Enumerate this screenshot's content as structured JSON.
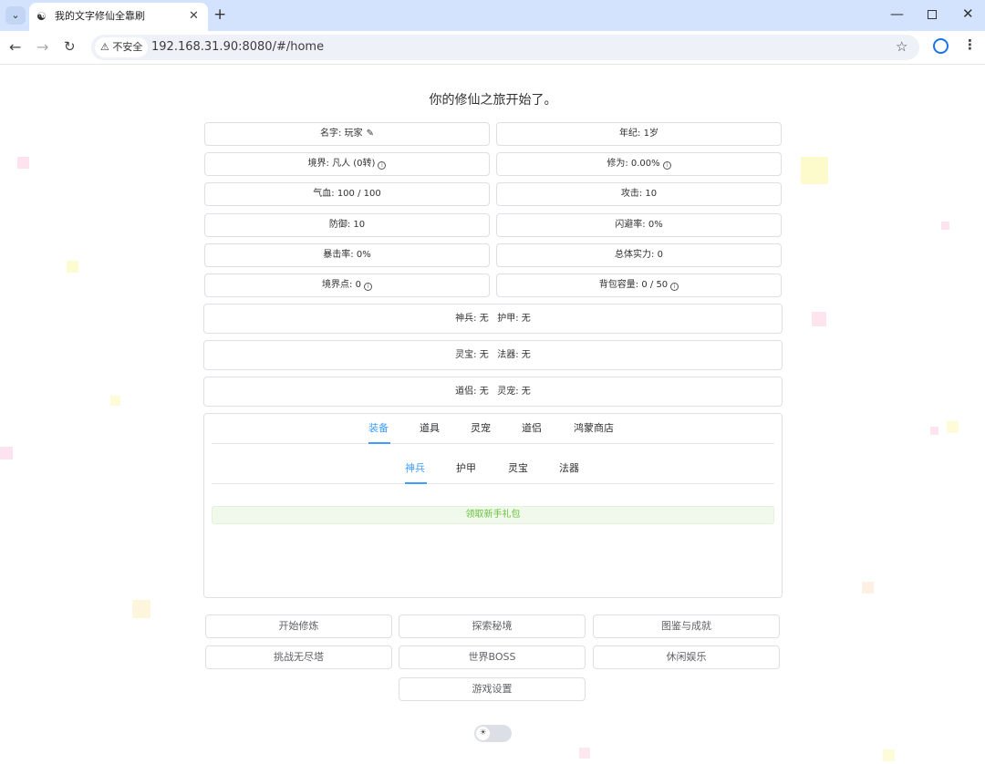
{
  "browser": {
    "tab_title": "我的文字修仙全靠刷",
    "tab_close": "✕",
    "new_tab": "+",
    "insecure_label": "不安全",
    "url": "192.168.31.90:8080/#/home"
  },
  "game": {
    "headline": "你的修仙之旅开始了。",
    "stats": {
      "name": "名字: 玩家",
      "age": "年纪: 1岁",
      "realm": "境界: 凡人 (0转)",
      "cultivation": "修为: 0.00%",
      "hp": "气血: 100 / 100",
      "attack": "攻击: 10",
      "defense": "防御: 10",
      "dodge": "闪避率: 0%",
      "crit": "暴击率: 0%",
      "power": "总体实力: 0",
      "realm_points": "境界点: 0",
      "bag": "背包容量: 0 / 50"
    },
    "equip_rows": [
      "神兵: 无   护甲: 无",
      "灵宝: 无   法器: 无",
      "道侣: 无   灵宠: 无"
    ],
    "main_tabs": [
      "装备",
      "道具",
      "灵宠",
      "道侣",
      "鸿蒙商店"
    ],
    "sub_tabs": [
      "神兵",
      "护甲",
      "灵宝",
      "法器"
    ],
    "gift_button": "领取新手礼包",
    "actions": [
      "开始修炼",
      "探索秘境",
      "图鉴与成就",
      "挑战无尽塔",
      "世界BOSS",
      "休闲娱乐",
      "游戏设置"
    ]
  },
  "colors": {
    "accent": "#409eff",
    "success_text": "#67c23a",
    "success_bg": "#f0f9eb",
    "chrome_tabbar": "#d3e3fd"
  },
  "icons": {
    "edit": "pencil-icon",
    "info": "info-circle-icon",
    "theme": "sun-icon"
  }
}
